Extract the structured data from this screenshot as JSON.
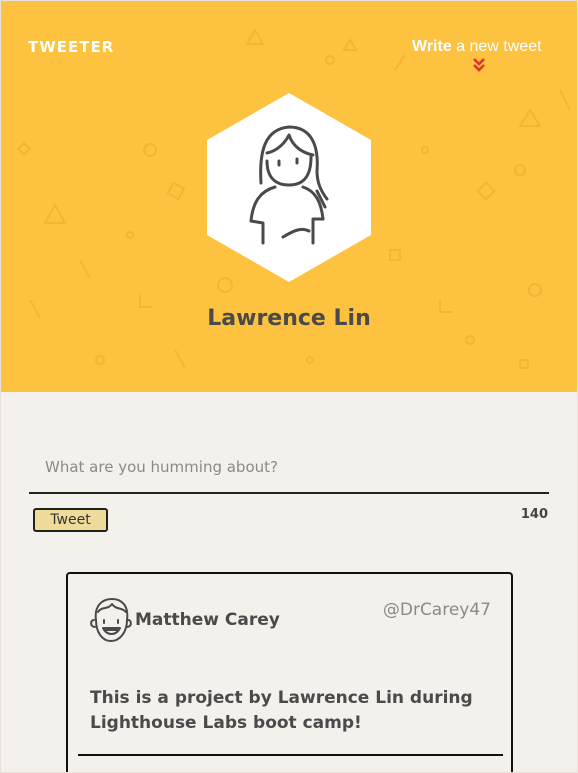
{
  "nav": {
    "brand": "TWEETER",
    "compose_strong": "Write",
    "compose_rest": " a new tweet",
    "compose_icon": "chevron-double-down-icon"
  },
  "profile": {
    "name": "Lawrence Lin",
    "avatar_icon": "user-avatar-icon"
  },
  "compose": {
    "placeholder": "What are you humming about?",
    "button_label": "Tweet",
    "counter": "140"
  },
  "tweets": [
    {
      "author": "Matthew Carey",
      "handle": "@DrCarey47",
      "content": "This is a project by Lawrence Lin during Lighthouse Labs boot camp!",
      "avatar_icon": "user-avatar-icon"
    }
  ],
  "colors": {
    "header_bg": "#fdc23f",
    "page_bg": "#f4f1ec",
    "accent_red": "#e3312b",
    "button_bg": "#f0dc9a"
  }
}
